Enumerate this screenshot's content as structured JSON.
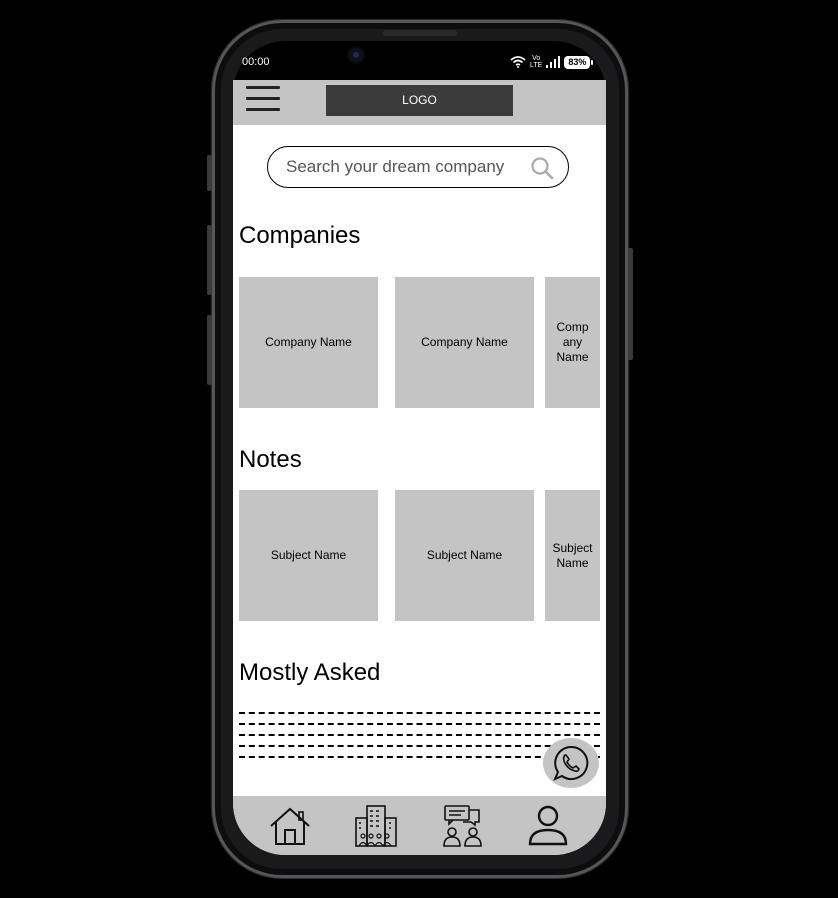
{
  "status_bar": {
    "time": "00:00",
    "network_top": "Vo",
    "network_bottom": "LTE",
    "battery": "83%"
  },
  "header": {
    "logo": "LOGO",
    "menu_icon": "hamburger-menu-icon"
  },
  "search": {
    "placeholder": "Search your dream company",
    "icon": "search-icon"
  },
  "companies": {
    "title": "Companies",
    "items": [
      {
        "label": "Company Name"
      },
      {
        "label": "Company Name"
      },
      {
        "label": "Comp any Name"
      }
    ]
  },
  "notes": {
    "title": "Notes",
    "items": [
      {
        "label": "Subject Name"
      },
      {
        "label": "Subject Name"
      },
      {
        "label": "Subject Name"
      }
    ]
  },
  "mostly_asked": {
    "title": "Mostly Asked"
  },
  "bottom_nav": {
    "items": [
      {
        "icon": "home-icon"
      },
      {
        "icon": "companies-building-icon"
      },
      {
        "icon": "community-chat-icon"
      },
      {
        "icon": "profile-icon"
      }
    ]
  },
  "colors": {
    "panel_gray": "#c4c4c4",
    "logo_bg": "#3b3b3b"
  }
}
